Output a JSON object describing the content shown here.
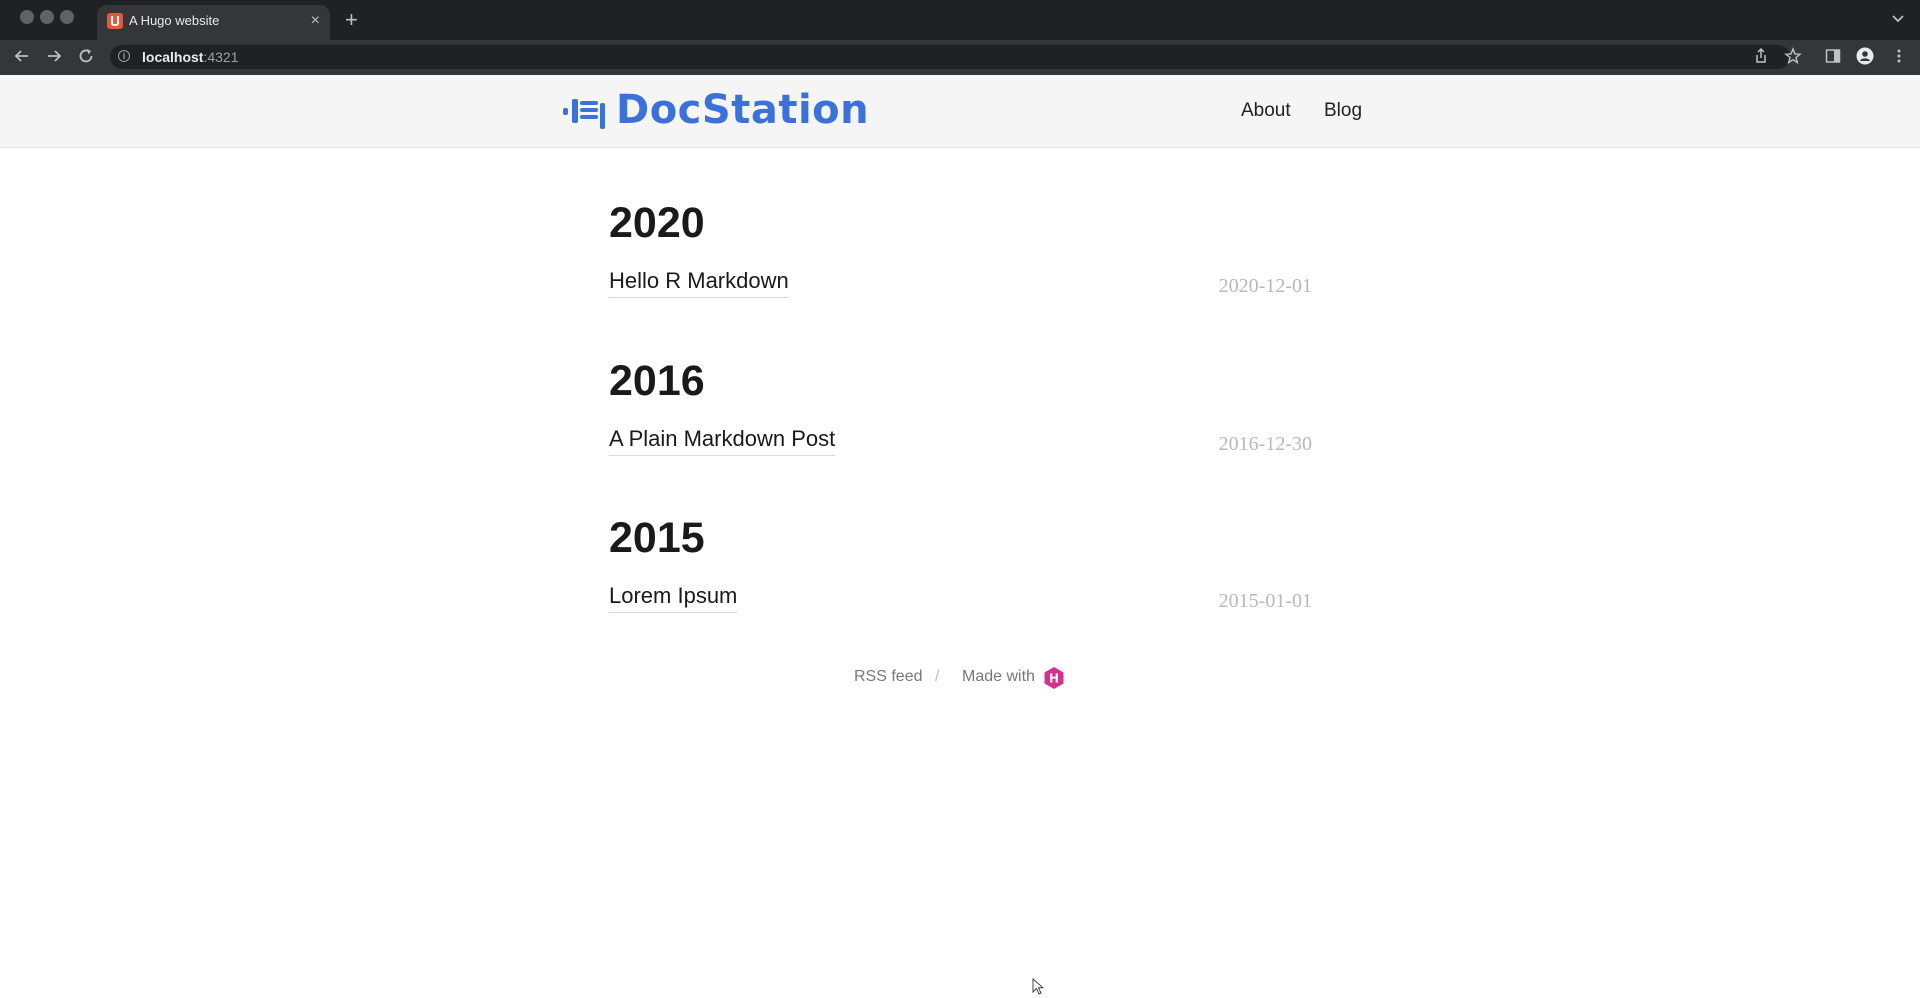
{
  "browser": {
    "tab_title": "A Hugo website",
    "new_tab_symbol": "+",
    "close_symbol": "×",
    "url_host": "localhost",
    "url_port": ":4321",
    "info_symbol": "i"
  },
  "site": {
    "logo_text": "DocStation",
    "brand_color": "#3b72d9",
    "nav": [
      {
        "label": "About"
      },
      {
        "label": "Blog"
      }
    ]
  },
  "archive": [
    {
      "year": "2020",
      "title": "Hello R Markdown",
      "date": "2020-12-01"
    },
    {
      "year": "2016",
      "title": "A Plain Markdown Post",
      "date": "2016-12-30"
    },
    {
      "year": "2015",
      "title": "Lorem Ipsum",
      "date": "2015-01-01"
    }
  ],
  "footer": {
    "rss": "RSS feed",
    "separator": "/",
    "made_with": "Made with",
    "hugo_letter": "H",
    "hugo_color": "#d6308f"
  }
}
